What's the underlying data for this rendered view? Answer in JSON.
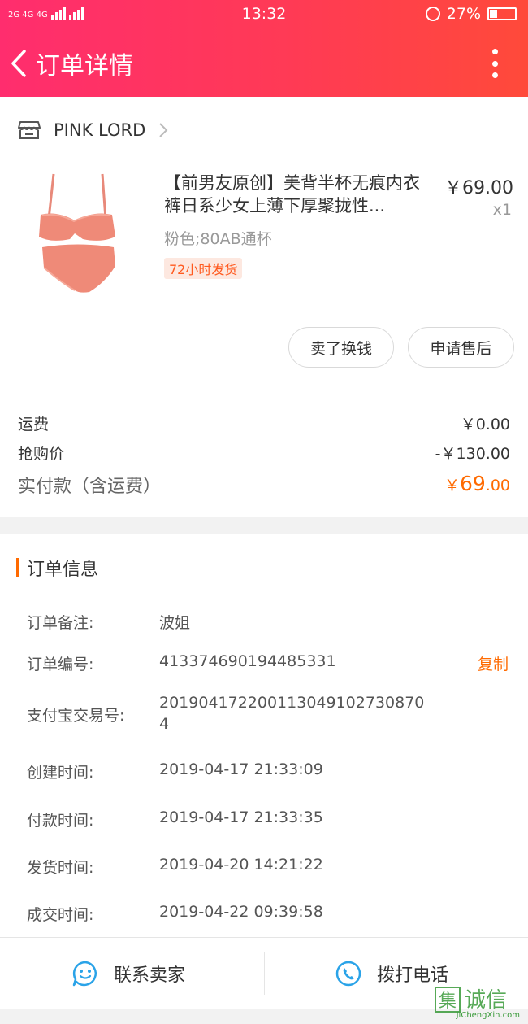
{
  "status_bar": {
    "network": "2G 4G 4G",
    "time": "13:32",
    "battery": "27%",
    "battery_level": 0.27
  },
  "header": {
    "title": "订单详情"
  },
  "shop": {
    "name": "PINK LORD"
  },
  "product": {
    "title": "【前男友原创】美背半杯无痕内衣裤日系少女上薄下厚聚拢性...",
    "price": "￥69.00",
    "quantity": "x1",
    "sku": "粉色;80AB通杯",
    "tag": "72小时发货"
  },
  "actions": {
    "sell_label": "卖了换钱",
    "aftersale_label": "申请售后"
  },
  "fees": {
    "shipping_label": "运费",
    "shipping_value": "￥0.00",
    "discount_label": "抢购价",
    "discount_value": "-￥130.00",
    "total_label": "实付款（含运费）",
    "total_currency": "￥",
    "total_int": "69",
    "total_dec": ".00"
  },
  "order_info": {
    "section_title": "订单信息",
    "rows": [
      {
        "label": "订单备注:",
        "value": "波姐"
      },
      {
        "label": "订单编号:",
        "value": "413374690194485331"
      },
      {
        "label": "支付宝交易号:",
        "value": "201904172200113049102730870\n4"
      },
      {
        "label": "创建时间:",
        "value": "2019-04-17 21:33:09"
      },
      {
        "label": "付款时间:",
        "value": "2019-04-17 21:33:35"
      },
      {
        "label": "发货时间:",
        "value": "2019-04-20 14:21:22"
      },
      {
        "label": "成交时间:",
        "value": "2019-04-22 09:39:58"
      }
    ],
    "copy_label": "复制"
  },
  "bottom_bar": {
    "contact_label": "联系卖家",
    "call_label": "拨打电话"
  },
  "watermark": {
    "logo_text": "集诚信",
    "site": "JiChengXin.com"
  },
  "colors": {
    "accent": "#ff6a00",
    "header_start": "#ff2d6e",
    "header_end": "#ff4a3a",
    "icon_blue": "#2aa3e8"
  }
}
